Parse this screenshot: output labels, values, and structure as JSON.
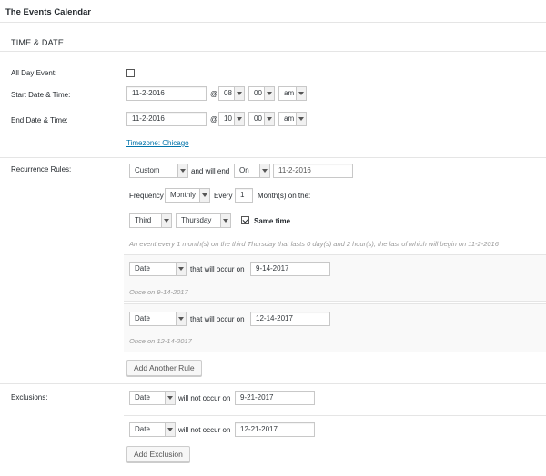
{
  "app": {
    "title": "The Events Calendar"
  },
  "section": {
    "title": "TIME & DATE"
  },
  "all_day": {
    "label": "All Day Event:",
    "checked": false
  },
  "start": {
    "label": "Start Date & Time:",
    "date": "11-2-2016",
    "at": "@",
    "hour": "08",
    "minute": "00",
    "meridian": "am"
  },
  "end": {
    "label": "End Date & Time:",
    "date": "11-2-2016",
    "at": "@",
    "hour": "10",
    "minute": "00",
    "meridian": "am"
  },
  "timezone": {
    "link": "Timezone: Chicago"
  },
  "recurrence": {
    "label": "Recurrence Rules:",
    "type": "Custom",
    "and_will_end": "and will end",
    "end_type": "On",
    "end_date_placeholder": "11-2-2016",
    "frequency_label": "Frequency",
    "frequency": "Monthly",
    "every_label": "Every",
    "every_value": "1",
    "month_on_label": "Month(s) on the:",
    "ordinal": "Third",
    "weekday": "Thursday",
    "same_time_label": "Same time",
    "same_time_checked": true,
    "summary": "An event every 1 month(s) on the third Thursday that lasts 0 day(s) and 2 hour(s), the last of which will begin on 11-2-2016"
  },
  "rules": [
    {
      "type": "Date",
      "occur_label": "that will occur on",
      "date": "9-14-2017",
      "summary": "Once on 9-14-2017"
    },
    {
      "type": "Date",
      "occur_label": "that will occur on",
      "date": "12-14-2017",
      "summary": "Once on 12-14-2017"
    }
  ],
  "add_rule_button": "Add Another Rule",
  "exclusions": {
    "label": "Exclusions:",
    "items": [
      {
        "type": "Date",
        "occur_label": "will not occur on",
        "date": "9-21-2017"
      },
      {
        "type": "Date",
        "occur_label": "will not occur on",
        "date": "12-21-2017"
      }
    ],
    "add_button": "Add Exclusion"
  }
}
